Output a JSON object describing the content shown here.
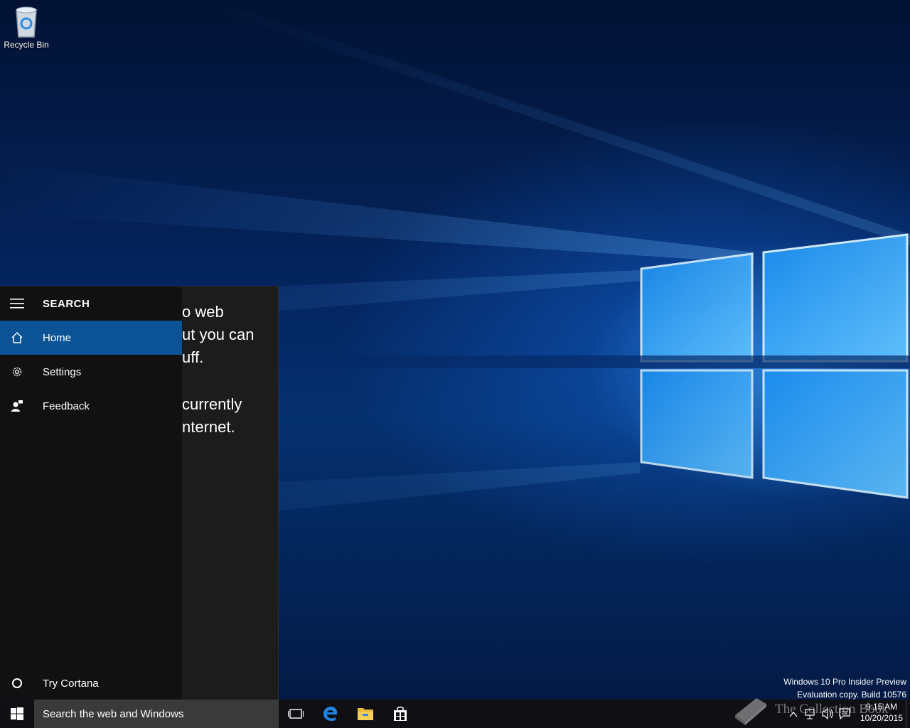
{
  "desktop": {
    "icons": [
      {
        "label": "Recycle Bin",
        "icon": "recycle-bin-icon"
      }
    ],
    "watermark": {
      "line1": "Windows 10 Pro Insider Preview",
      "line2": "Evaluation copy. Build 10576"
    }
  },
  "search_panel": {
    "menu_title": "SEARCH",
    "menu_items": [
      {
        "label": "Home",
        "icon": "home-icon",
        "active": true
      },
      {
        "label": "Settings",
        "icon": "gear-icon",
        "active": false
      },
      {
        "label": "Feedback",
        "icon": "feedback-icon",
        "active": false
      }
    ],
    "footer_item": {
      "label": "Try Cortana",
      "icon": "cortana-circle-icon"
    },
    "content_fragments": [
      "o web",
      "ut you can",
      "uff.",
      "currently",
      "nternet."
    ]
  },
  "taskbar": {
    "search_placeholder": "Search the web and Windows",
    "pinned_apps": [
      {
        "name": "task-view-icon"
      },
      {
        "name": "edge-icon"
      },
      {
        "name": "file-explorer-icon"
      },
      {
        "name": "store-icon"
      }
    ],
    "clock": {
      "time": "9:15 AM",
      "date": "10/20/2015"
    },
    "tray_icons": [
      "chevron-up-icon",
      "network-icon",
      "volume-icon",
      "action-center-icon"
    ]
  },
  "overlay_brand": "The Collection Book",
  "colors": {
    "accent": "#0b5394",
    "panel_bg": "#1c1c1c",
    "menu_bg": "#111111",
    "taskbar_bg": "#101014",
    "search_box_bg": "#3a3a3a"
  }
}
